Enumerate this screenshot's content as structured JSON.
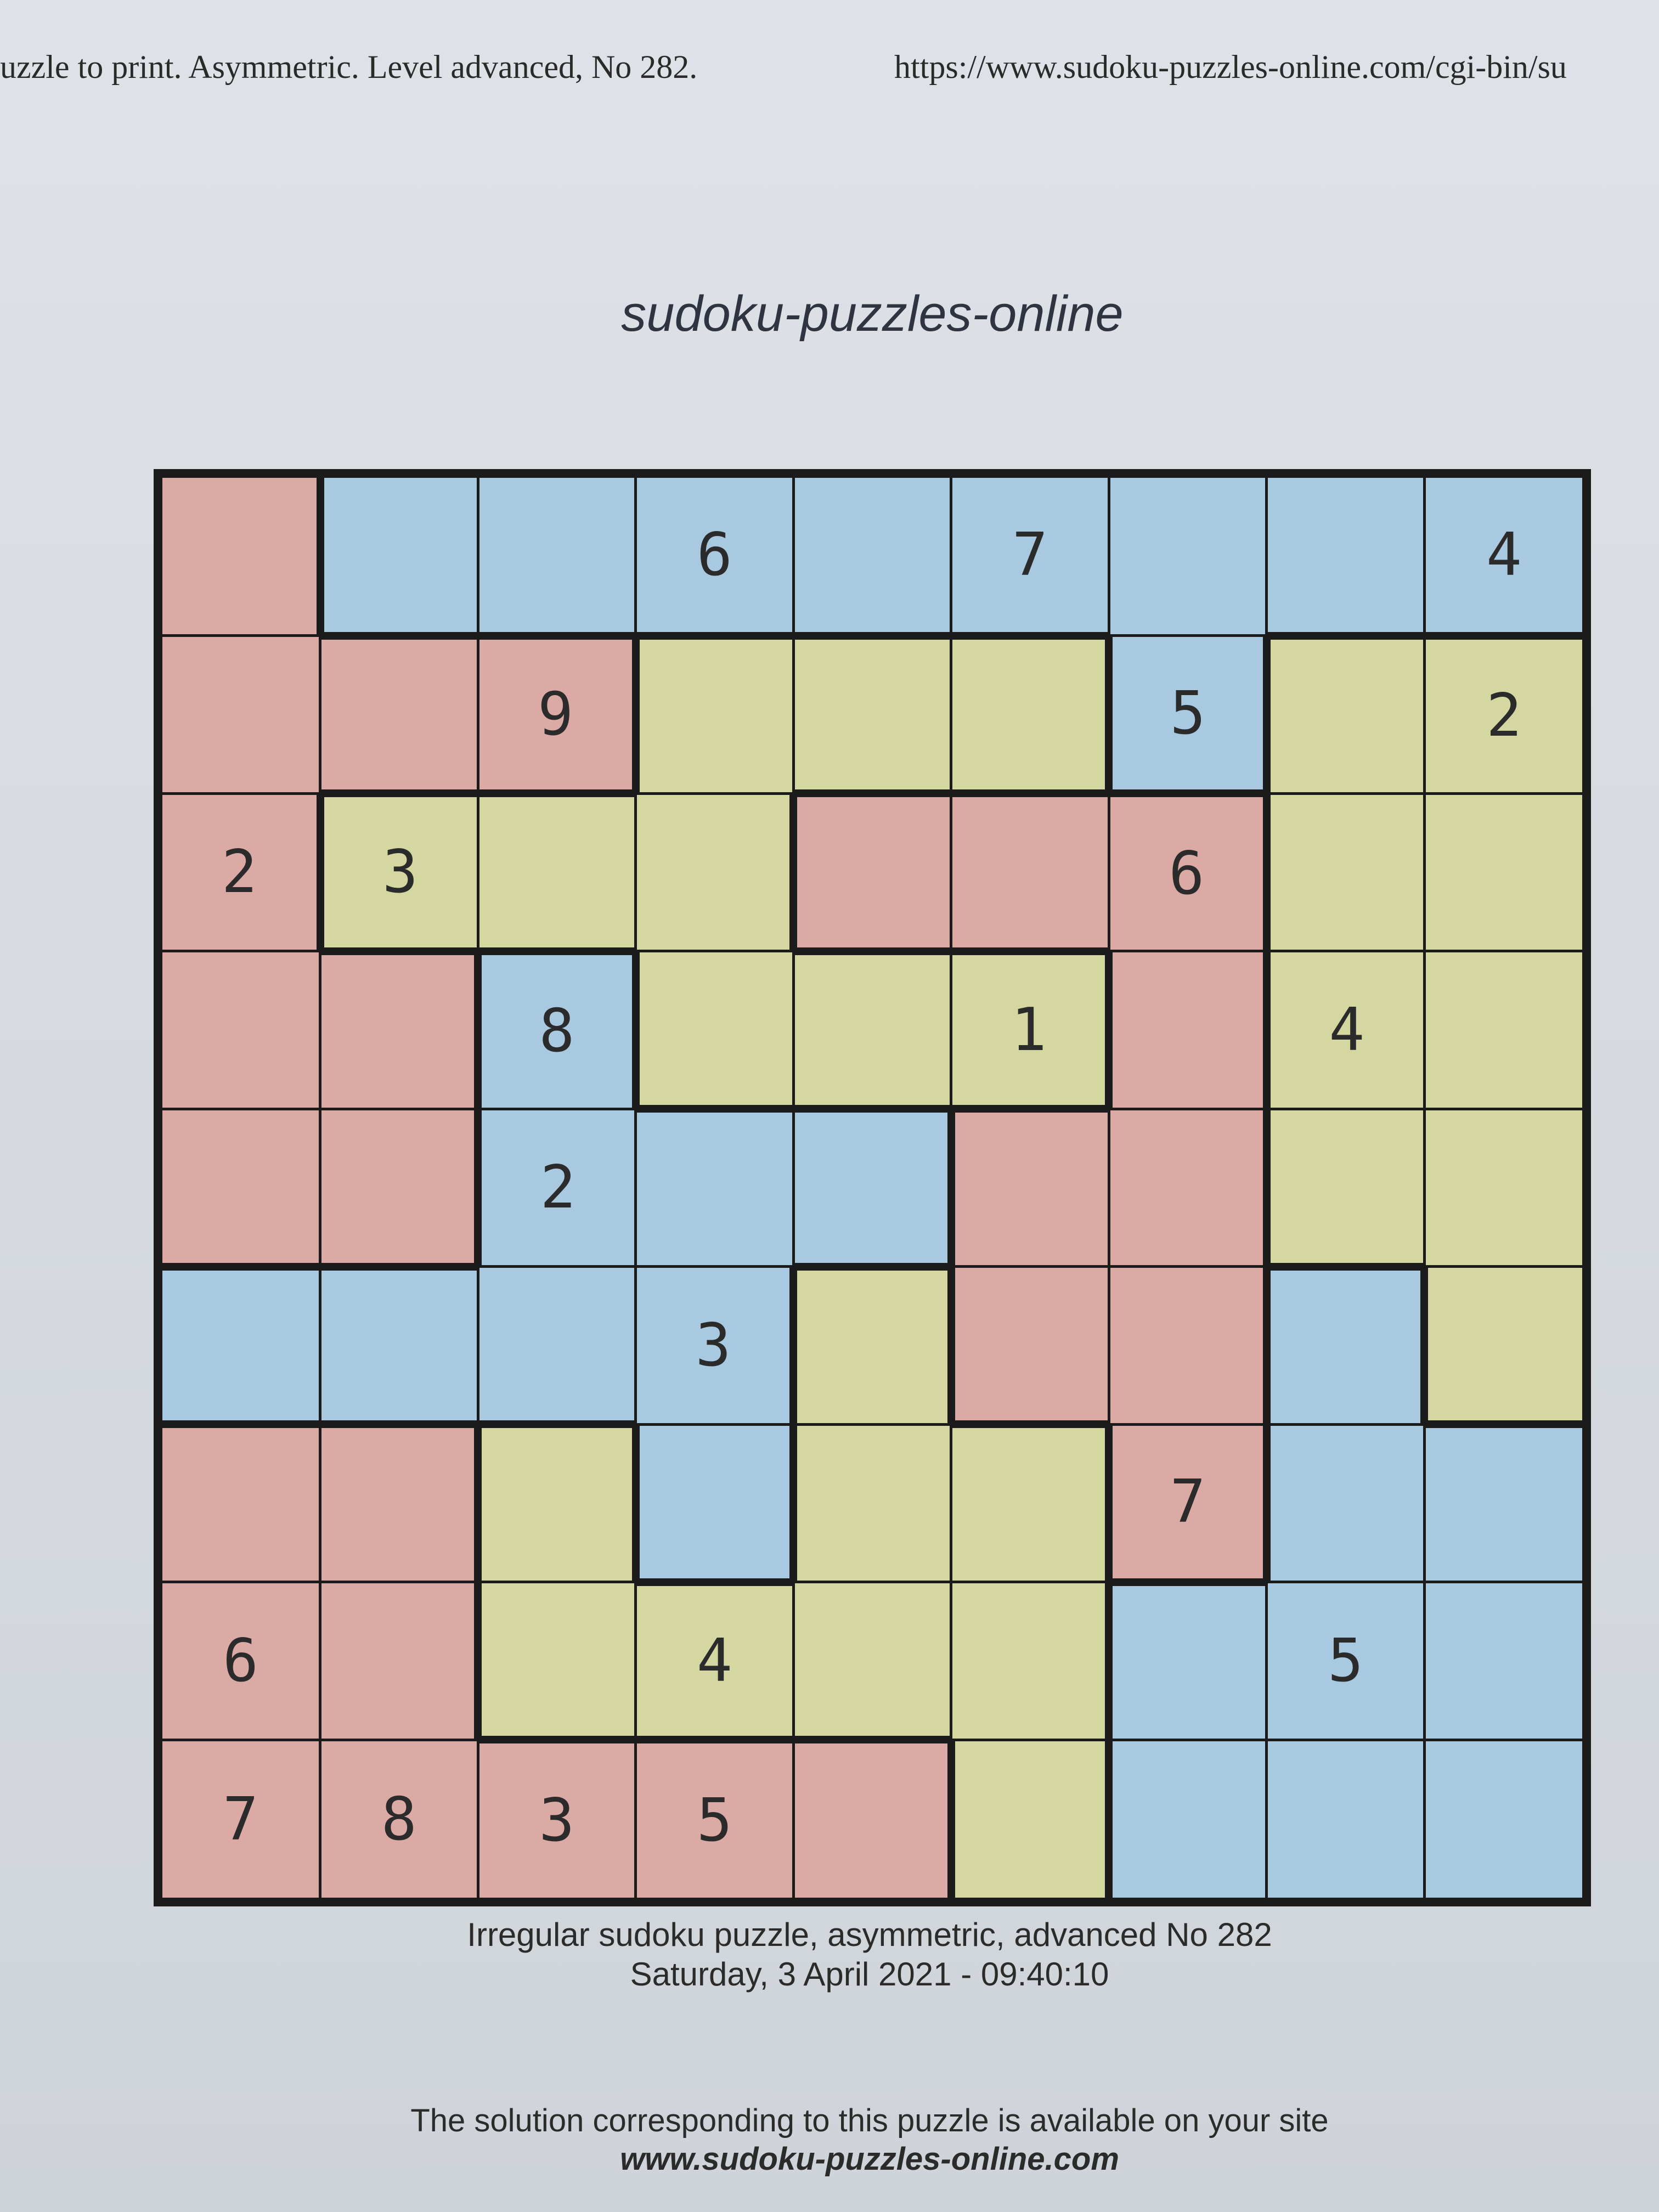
{
  "header": {
    "left_text": "uzzle to print. Asymmetric. Level advanced, No 282.",
    "right_text": "https://www.sudoku-puzzles-online.com/cgi-bin/su"
  },
  "site_title": "sudoku-puzzles-online",
  "colors": {
    "r": "#dcaaa5",
    "b": "#a8c9e0",
    "y": "#d4d7a0",
    "border": "#1b1b1b"
  },
  "puzzle": {
    "regions": [
      "rbbbbbbbb",
      "rrryyybyy",
      "ryyyrrryy",
      "rrbyyyryy",
      "rrbbbrryy",
      "bbbbyrrby",
      "rrybyyrbb",
      "rryyyybbb",
      "rrrrrybbb"
    ],
    "cells": [
      [
        "",
        "",
        "",
        "6",
        "",
        "7",
        "",
        "",
        "4"
      ],
      [
        "",
        "",
        "9",
        "",
        "",
        "",
        "5",
        "",
        "2"
      ],
      [
        "2",
        "3",
        "",
        "",
        "",
        "",
        "6",
        "",
        ""
      ],
      [
        "",
        "",
        "8",
        "",
        "",
        "1",
        "",
        "4",
        ""
      ],
      [
        "",
        "",
        "2",
        "",
        "",
        "",
        "",
        "",
        ""
      ],
      [
        "",
        "",
        "",
        "3",
        "",
        "",
        "",
        "",
        ""
      ],
      [
        "",
        "",
        "",
        "",
        "",
        "",
        "7",
        "",
        ""
      ],
      [
        "6",
        "",
        "",
        "4",
        "",
        "",
        "",
        "5",
        ""
      ],
      [
        "7",
        "8",
        "3",
        "5",
        "",
        "",
        "",
        "",
        ""
      ]
    ]
  },
  "caption": {
    "line1": "Irregular sudoku puzzle, asymmetric, advanced No 282",
    "line2": "Saturday, 3 April 2021 - 09:40:10"
  },
  "footer": {
    "line1": "The solution corresponding to this puzzle is available on your site",
    "line2": "www.sudoku-puzzles-online.com"
  }
}
